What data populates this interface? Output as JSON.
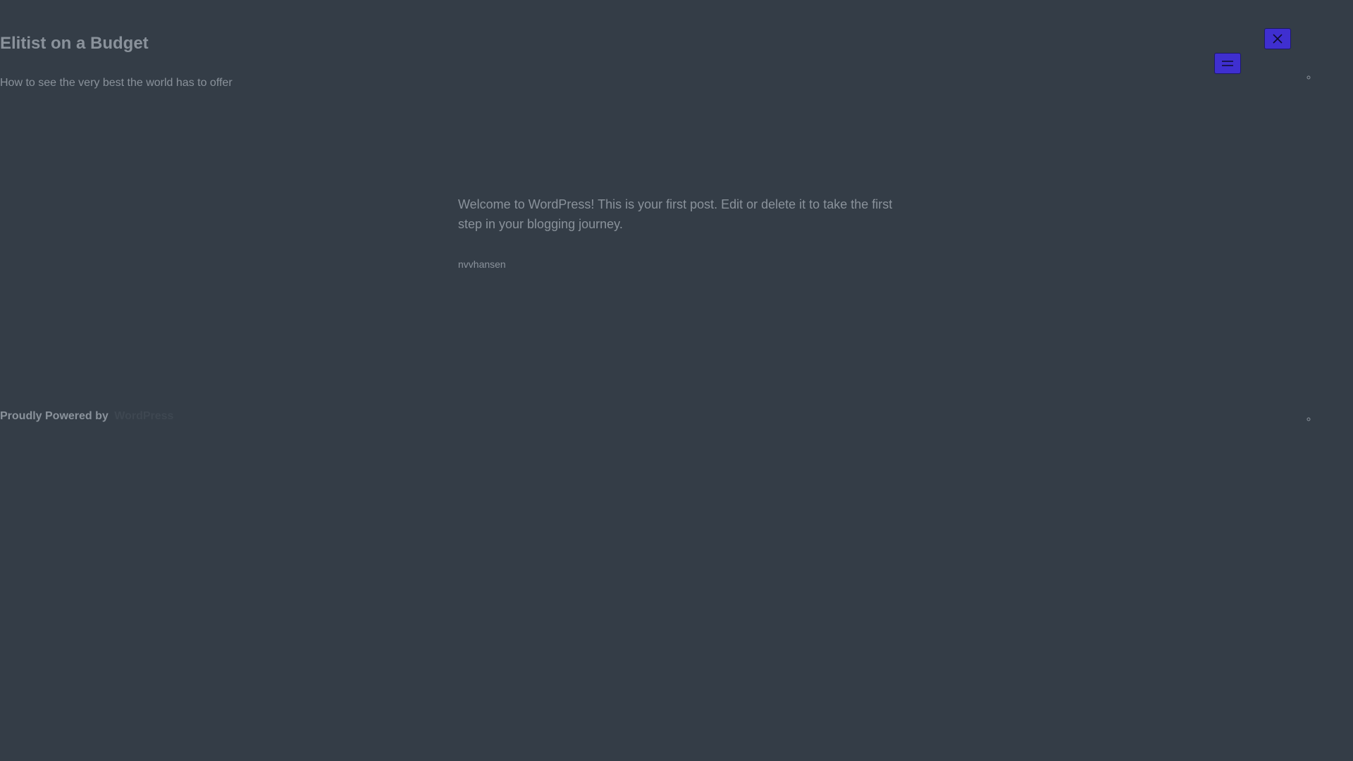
{
  "header": {
    "site_title": "Elitist on a Budget",
    "tagline": "How to see the very best the world has to offer",
    "close_button_label": "Close menu",
    "menu_button_label": "Open menu"
  },
  "post": {
    "excerpt": "Welcome to WordPress! This is your first post. Edit or delete it to take the first step in your blogging journey.",
    "author": "nvvhansen"
  },
  "footer": {
    "powered_label": "Proudly Powered by",
    "powered_link": "WordPress"
  },
  "colors": {
    "background": "#343d47",
    "text": "#8a929b",
    "button_fill": "#3f2fd0"
  }
}
